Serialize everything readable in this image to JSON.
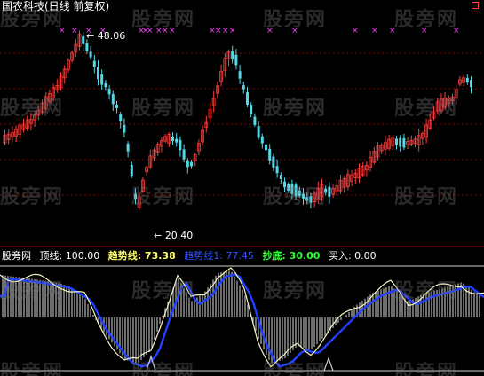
{
  "header": {
    "title": "国农科技(日线 前复权)"
  },
  "watermark": "股旁网",
  "price_chart": {
    "high_label": "48.06",
    "low_label": "20.40",
    "high_value": 48.06,
    "low_value": 20.4
  },
  "indicator_legend": {
    "name": "股旁网",
    "items": [
      {
        "label": "顶线: 100.00",
        "color": "#ffffff"
      },
      {
        "label": "趋势线: 73.38",
        "color": "#ffff66"
      },
      {
        "label": "趋势线1: 77.45",
        "color": "#3355ff"
      },
      {
        "label": "抄底: 30.00",
        "color": "#33ff33"
      },
      {
        "label": "买入: 0.00",
        "color": "#ffffff"
      }
    ]
  },
  "colors": {
    "up": "#ff3b3b",
    "down": "#54d8e8",
    "grid": "#8a0000",
    "marker": "#ff44ff",
    "trend_white": "#f5f5c8",
    "trend_blue": "#2040ff",
    "histogram": "#9a9a9a"
  }
}
